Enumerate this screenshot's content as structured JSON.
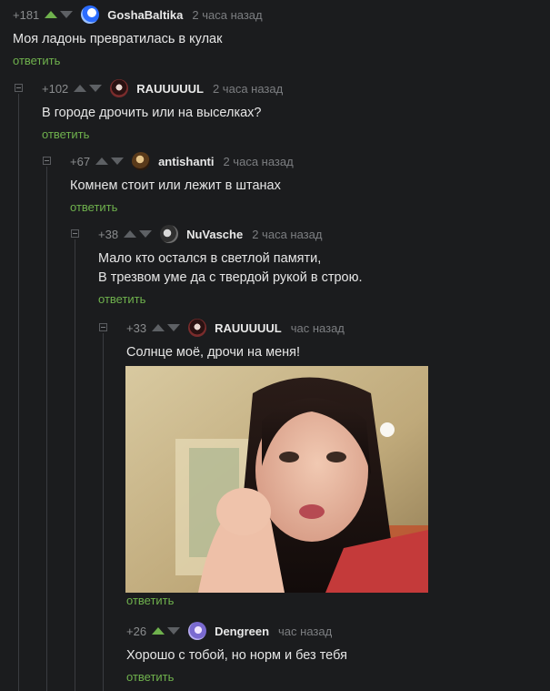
{
  "reply_label": "ответить",
  "comments": [
    {
      "score": "+181",
      "author": "GoshaBaltika",
      "time": "2 часа назад",
      "lines": [
        "Моя ладонь превратилась в кулак"
      ],
      "upvoted": true
    },
    {
      "score": "+102",
      "author": "RAUUUUUL",
      "time": "2 часа назад",
      "lines": [
        "В городе дрочить или на выселках?"
      ],
      "upvoted": false
    },
    {
      "score": "+67",
      "author": "antishanti",
      "time": "2 часа назад",
      "lines": [
        "Комнем стоит или лежит в штанах"
      ],
      "upvoted": false
    },
    {
      "score": "+38",
      "author": "NuVasche",
      "time": "2 часа назад",
      "lines": [
        "Мало кто остался в светлой памяти,",
        "В трезвом уме да с твердой рукой в строю."
      ],
      "upvoted": false
    },
    {
      "score": "+33",
      "author": "RAUUUUUL",
      "time": "час назад",
      "lines": [
        "Солнце моё, дрочи на меня!"
      ],
      "upvoted": false
    },
    {
      "score": "+26",
      "author": "Dengreen",
      "time": "час назад",
      "lines": [
        "Хорошо с тобой, но норм и без тебя"
      ],
      "upvoted": true
    }
  ],
  "colors": {
    "background": "#1b1c1e",
    "reply_link": "#6fb14d",
    "upvote_active": "#6fb14d",
    "arrow_idle": "#5d6064"
  }
}
